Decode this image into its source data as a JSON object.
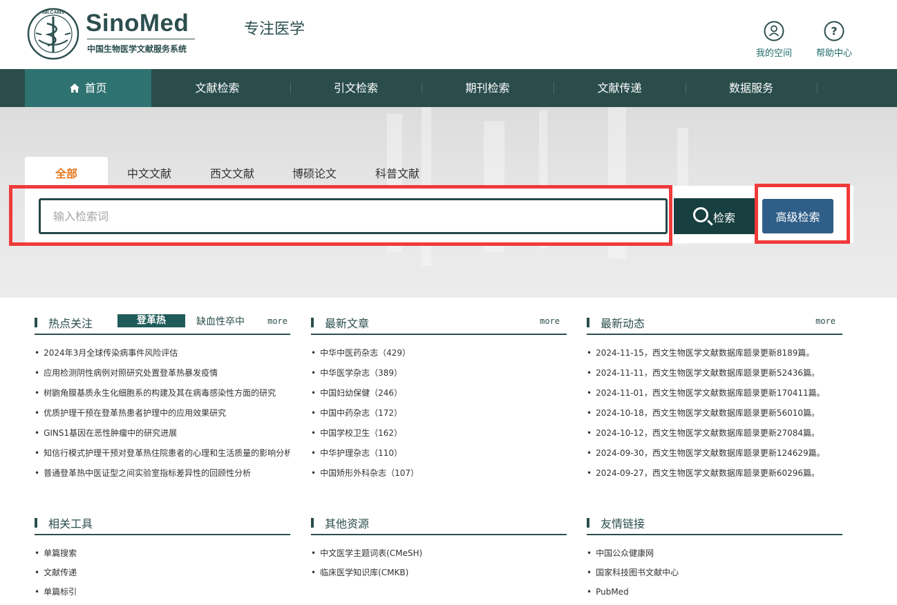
{
  "header": {
    "seal_text": "IMI.CAMS",
    "logo_title": "SinoMed",
    "logo_subtitle": "中国生物医学文献服务系统",
    "slogan": "专注医学",
    "my_space": "我的空间",
    "help_center": "帮助中心"
  },
  "nav": [
    {
      "label": "首页",
      "icon": "home-icon"
    },
    {
      "label": "文献检索"
    },
    {
      "label": "引文检索"
    },
    {
      "label": "期刊检索"
    },
    {
      "label": "文献传递"
    },
    {
      "label": "数据服务"
    }
  ],
  "search": {
    "tabs": [
      "全部",
      "中文文献",
      "西文文献",
      "博硕论文",
      "科普文献"
    ],
    "placeholder": "输入检索词",
    "value": "",
    "search_label": "检索",
    "advanced_label": "高级检索"
  },
  "hot": {
    "title": "热点关注",
    "tag_active": "登革热",
    "tag_other": "缺血性卒中",
    "more": "more",
    "items": [
      "2024年3月全球传染病事件风险评估",
      "应用检测阴性病例对照研究处置登革热暴发疫情",
      "树鼩角膜基质永生化细胞系的构建及其在病毒感染性方面的研究",
      "优质护理干预在登革热患者护理中的应用效果研究",
      "GINS1基因在恶性肿瘤中的研究进展",
      "知信行模式护理干预对登革热住院患者的心理和生活质量的影响分析",
      "普通登革热中医证型之间实验室指标差异性的回顾性分析"
    ]
  },
  "latest_articles": {
    "title": "最新文章",
    "more": "more",
    "items": [
      "中华中医药杂志（429）",
      "中华医学杂志（389）",
      "中国妇幼保健（246）",
      "中国中药杂志（172）",
      "中国学校卫生（162）",
      "中华护理杂志（110）",
      "中国矫形外科杂志（107）"
    ]
  },
  "latest_news": {
    "title": "最新动态",
    "more": "more",
    "items": [
      "2024-11-15，西文生物医学文献数据库题录更新8189篇。",
      "2024-11-11，西文生物医学文献数据库题录更新52436篇。",
      "2024-11-01，西文生物医学文献数据库题录更新170411篇。",
      "2024-10-18，西文生物医学文献数据库题录更新56010篇。",
      "2024-10-12，西文生物医学文献数据库题录更新27084篇。",
      "2024-09-30，西文生物医学文献数据库题录更新124629篇。",
      "2024-09-27，西文生物医学文献数据库题录更新60296篇。"
    ]
  },
  "tools": {
    "title": "相关工具",
    "items": [
      "单篇搜索",
      "文献传递",
      "单篇标引"
    ]
  },
  "other_resources": {
    "title": "其他资源",
    "items": [
      "中文医学主题词表(CMeSH)",
      "临床医学知识库(CMKB)"
    ]
  },
  "friend_links": {
    "title": "友情链接",
    "items": [
      "中国公众健康网",
      "国家科技图书文献中心",
      "PubMed"
    ]
  },
  "colors": {
    "brand_dark": "#2a4d4c",
    "nav_active": "#2e7371",
    "accent_orange": "#e6781e",
    "advanced_button": "#2f5f88",
    "highlight": "#f03a3a"
  }
}
